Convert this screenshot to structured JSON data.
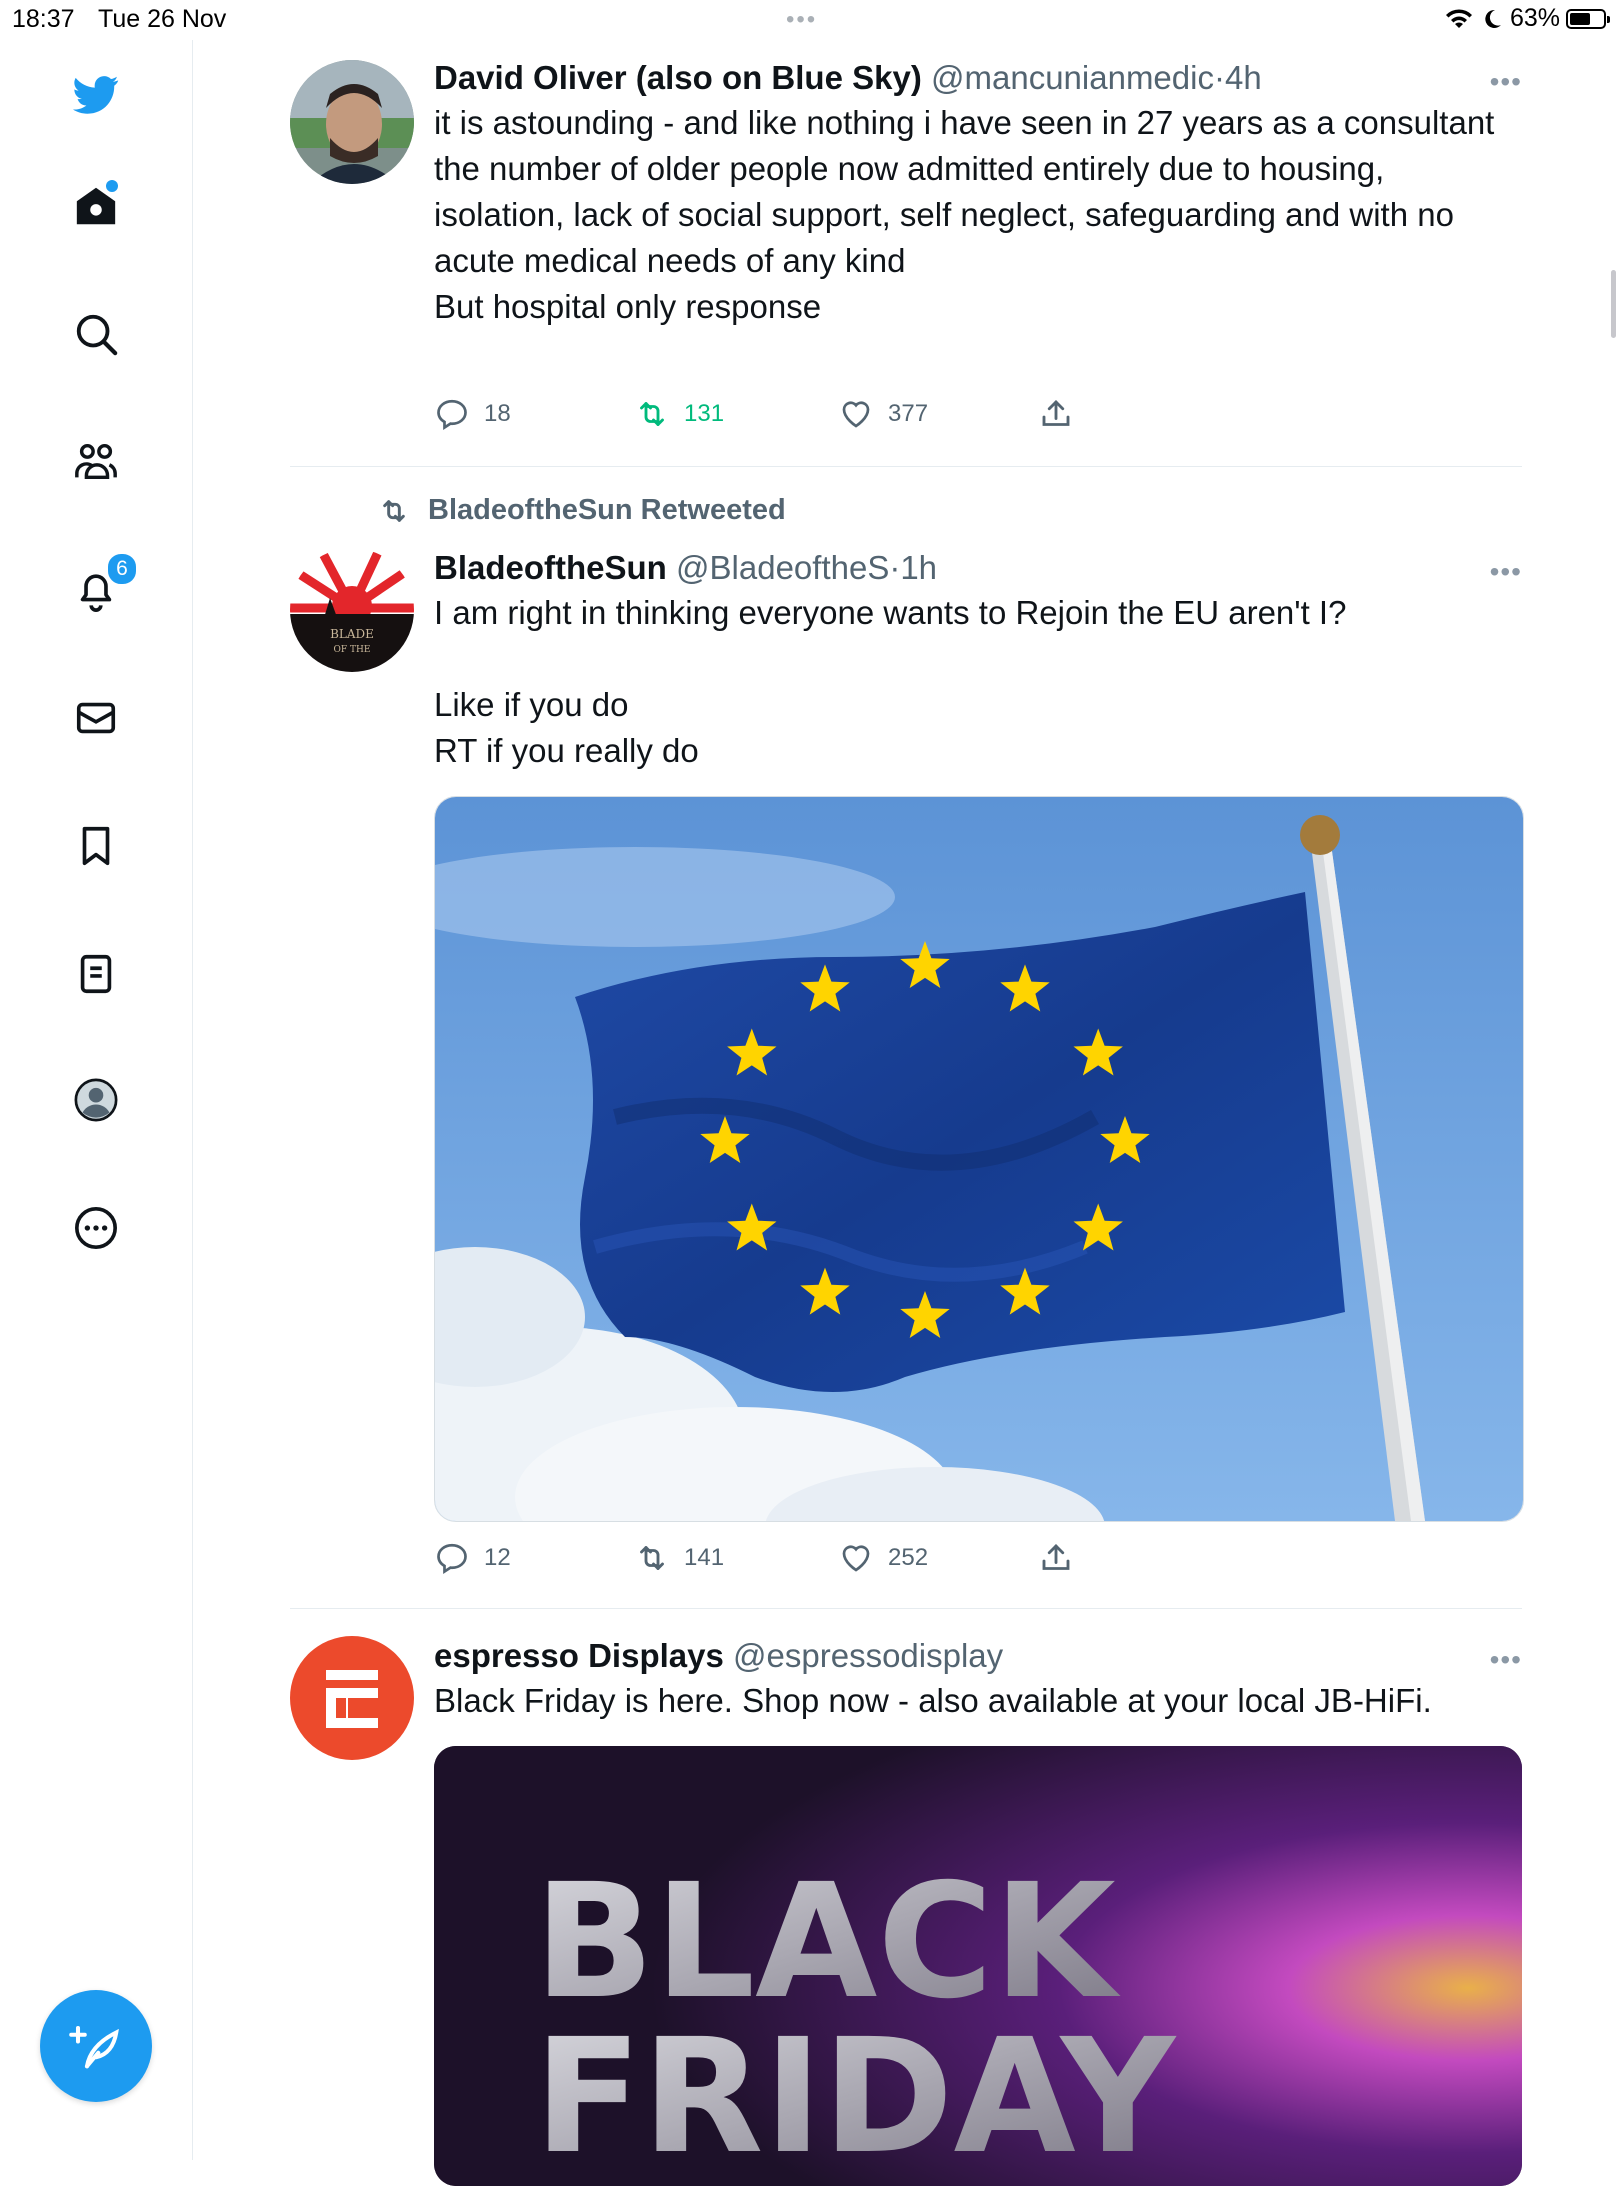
{
  "status_bar": {
    "time": "18:37",
    "date": "Tue 26 Nov",
    "dots": "•••",
    "battery": "63%",
    "battery_level": 0.63
  },
  "sidebar": {
    "items": [
      {
        "name": "twitter-logo",
        "icon": "twitter-bird-icon"
      },
      {
        "name": "home",
        "icon": "home-icon",
        "has_dot": true
      },
      {
        "name": "search",
        "icon": "search-icon"
      },
      {
        "name": "communities",
        "icon": "communities-icon"
      },
      {
        "name": "notifications",
        "icon": "bell-icon",
        "badge": "6"
      },
      {
        "name": "messages",
        "icon": "mail-icon"
      },
      {
        "name": "bookmarks",
        "icon": "bookmark-icon"
      },
      {
        "name": "lists",
        "icon": "lists-icon"
      },
      {
        "name": "profile",
        "icon": "profile-icon"
      },
      {
        "name": "more",
        "icon": "more-circle-icon"
      }
    ],
    "compose_icon": "compose-feather-icon"
  },
  "colors": {
    "accent": "#1d9bf0",
    "retweet_green": "#00ba7c",
    "muted": "#536471",
    "divider": "#e6ecf0"
  },
  "tweets": [
    {
      "name": "David Oliver (also on Blue Sky)",
      "handle": "@mancunianmedic",
      "sep": "·",
      "time": "4h",
      "more": "•••",
      "text": "it is astounding - and like nothing i have seen in 27 years as a consultant\nthe number of older people now admitted entirely due to housing, isolation, lack of social support, self neglect, safeguarding and with no acute medical needs of any kind\nBut hospital only response",
      "replies": "18",
      "retweets": "131",
      "likes": "377"
    },
    {
      "retweeted_by": "BladeoftheSun Retweeted",
      "name": "BladeoftheSun",
      "handle": "@BladeoftheS",
      "sep": "·",
      "time": "1h",
      "more": "•••",
      "text": "I am right in thinking everyone wants to Rejoin the EU aren't I?\n\nLike if you do\nRT if you really do",
      "avatar_text_1": "BLADE",
      "avatar_text_2": "OF THE",
      "replies": "12",
      "retweets": "141",
      "likes": "252"
    },
    {
      "name": "espresso Displays",
      "handle": "@espressodisplay",
      "more": "•••",
      "text": "Black Friday is here. Shop now - also available at your local JB-HiFi.",
      "media_line_1": "BLACK",
      "media_line_2": "FRIDAY"
    }
  ]
}
